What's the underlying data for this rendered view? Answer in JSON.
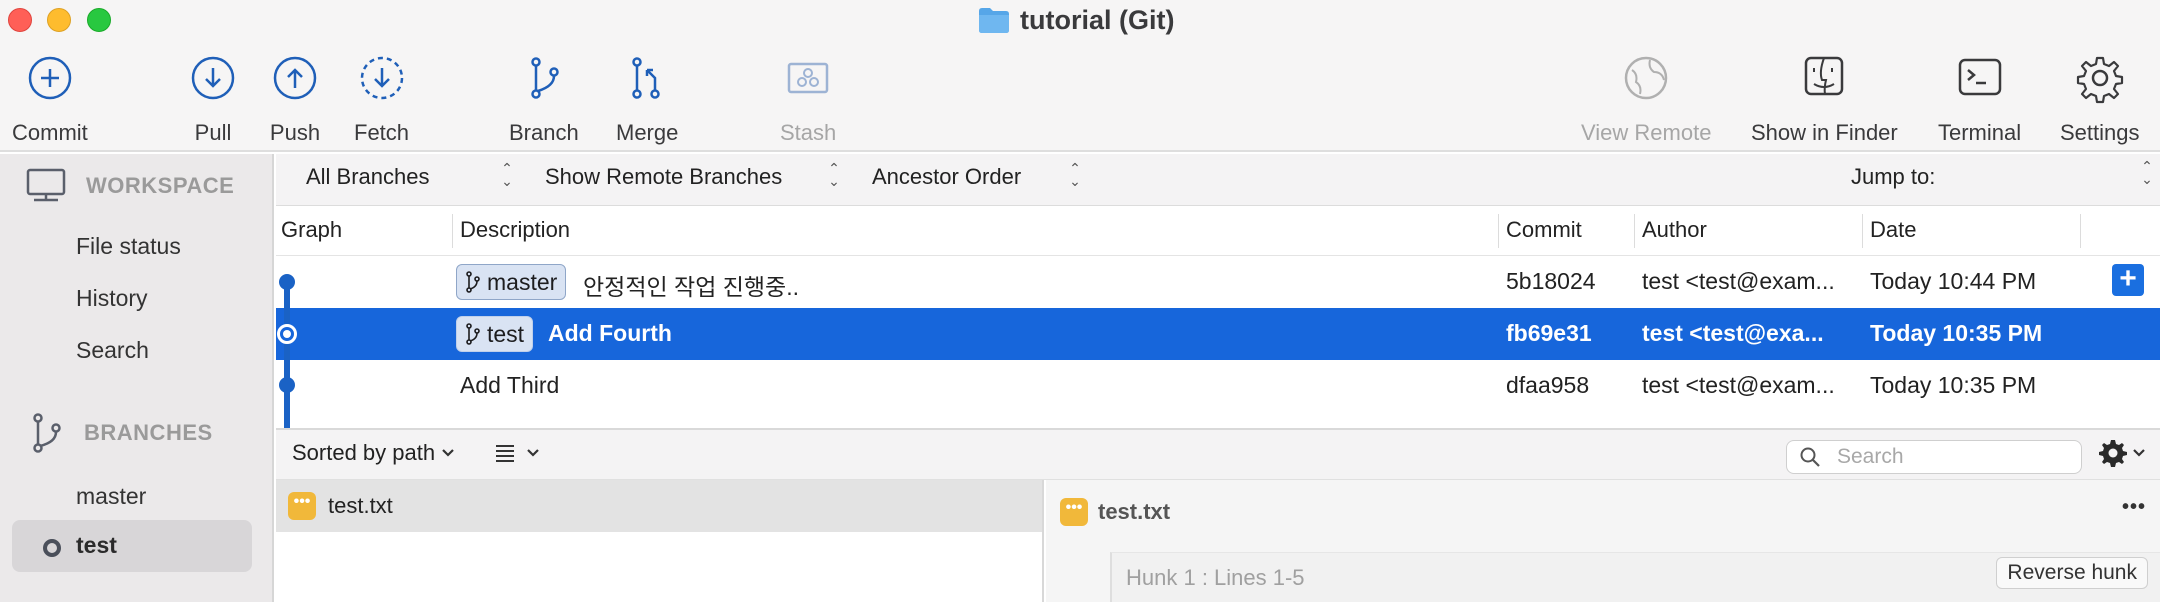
{
  "window": {
    "title": "tutorial (Git)",
    "title_icon": "folder-icon"
  },
  "toolbar": {
    "commit": "Commit",
    "pull": "Pull",
    "push": "Push",
    "fetch": "Fetch",
    "branch": "Branch",
    "merge": "Merge",
    "stash": "Stash",
    "view_remote": "View Remote",
    "show_in_finder": "Show in Finder",
    "terminal": "Terminal",
    "settings": "Settings"
  },
  "sidebar": {
    "workspace_header": "WORKSPACE",
    "workspace_items": [
      "File status",
      "History",
      "Search"
    ],
    "branches_header": "BRANCHES",
    "branches": [
      "master",
      "test"
    ]
  },
  "filters": {
    "branches": "All Branches",
    "remote": "Show Remote Branches",
    "order": "Ancestor Order",
    "jump_to": "Jump to:"
  },
  "table": {
    "columns": [
      "Graph",
      "Description",
      "Commit",
      "Author",
      "Date"
    ],
    "rows": [
      {
        "branch": "master",
        "description": "안정적인 작업 진행중..",
        "commit": "5b18024",
        "author": "test <test@exam...",
        "date": "Today 10:44 PM",
        "selected": false
      },
      {
        "branch": "test",
        "description": "Add Fourth",
        "commit": "fb69e31",
        "author": "test <test@exa...",
        "date": "Today 10:35 PM",
        "selected": true
      },
      {
        "branch": "",
        "description": "Add Third",
        "commit": "dfaa958",
        "author": "test <test@exam...",
        "date": "Today 10:35 PM",
        "selected": false
      }
    ],
    "add_symbol": "+"
  },
  "lower": {
    "sort_label": "Sorted by path",
    "search_placeholder": "Search",
    "file_name": "test.txt",
    "diff_file_name": "test.txt",
    "more_symbol": "•••",
    "hunk_label": "Hunk 1 : Lines 1-5",
    "reverse_hunk": "Reverse hunk",
    "badge_symbol": "•••"
  },
  "colors": {
    "accent": "#1766db",
    "graph": "#1a62c5",
    "modified_badge": "#f1b83a"
  }
}
